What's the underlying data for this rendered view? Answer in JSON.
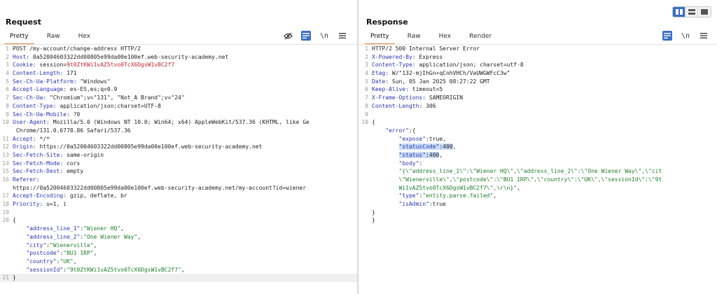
{
  "request": {
    "title": "Request",
    "tabs": [
      {
        "label": "Pretty",
        "active": true
      },
      {
        "label": "Raw",
        "active": false
      },
      {
        "label": "Hex",
        "active": false
      }
    ],
    "newline_toggle": "\\n",
    "lines": [
      {
        "n": "1",
        "text": "POST /my-account/change-address HTTP/2"
      },
      {
        "n": "2",
        "key": "Host:",
        "val": " 0a52004603322dd00805e99da00e100ef.web-security-academy.net"
      },
      {
        "n": "3",
        "key": "Cookie:",
        "val": " session=",
        "red": "9t0ZtKWi1vAZ5tvo0TcX6DgsW1vBC2f7"
      },
      {
        "n": "4",
        "key": "Content-Length:",
        "val": " 171"
      },
      {
        "n": "5",
        "key": "Sec-Ch-Ua-Platform:",
        "val": " \"Windows\""
      },
      {
        "n": "6",
        "key": "Accept-Language:",
        "val": " es-ES,es;q=0.9"
      },
      {
        "n": "7",
        "key": "Sec-Ch-Ua:",
        "val": " \"Chromium\";v=\"131\", \"Not_A Brand\";v=\"24\""
      },
      {
        "n": "8",
        "key": "Content-Type:",
        "val": " application/json;charset=UTF-8"
      },
      {
        "n": "9",
        "key": "Sec-Ch-Ua-Mobile:",
        "val": " ?0"
      },
      {
        "n": "10",
        "key": "User-Agent:",
        "val": " Mozilla/5.0 (Windows NT 10.0; Win64; x64) AppleWebKit/537.36 (KHTML, like Ge"
      },
      {
        "n": "",
        "val": " Chrome/131.0.6778.86 Safari/537.36"
      },
      {
        "n": "11",
        "key": "Accept:",
        "val": " */*"
      },
      {
        "n": "12",
        "key": "Origin:",
        "val": " https://0a52004603322dd00805e99da00e100ef.web-security-academy.net"
      },
      {
        "n": "13",
        "key": "Sec-Fetch-Site:",
        "val": " same-origin"
      },
      {
        "n": "14",
        "key": "Sec-Fetch-Mode:",
        "val": " cors"
      },
      {
        "n": "15",
        "key": "Sec-Fetch-Dest:",
        "val": " empty"
      },
      {
        "n": "16",
        "key": "Referer:",
        "val": ""
      },
      {
        "n": "",
        "val": "https://0a52004603322dd00805e99da00e100ef.web-security-academy.net/my-account?id=wiener"
      },
      {
        "n": "17",
        "key": "Accept-Encoding:",
        "val": " gzip, deflate, br"
      },
      {
        "n": "18",
        "key": "Priority:",
        "val": " u=1, i"
      },
      {
        "n": "19",
        "val": ""
      },
      {
        "n": "20",
        "val": "{"
      },
      {
        "n": "",
        "indent": "    ",
        "jkey": "\"address_line_1\"",
        "jval": "\"Wiener HQ\"",
        "tail": ","
      },
      {
        "n": "",
        "indent": "    ",
        "jkey": "\"address_line_2\"",
        "jval": "\"One Wiener Way\"",
        "tail": ","
      },
      {
        "n": "",
        "indent": "    ",
        "jkey": "\"city\"",
        "jval": "\"Wienerville\"",
        "tail": ","
      },
      {
        "n": "",
        "indent": "    ",
        "jkey": "\"postcode\"",
        "jval": "\"BU1 1RP\"",
        "tail": ","
      },
      {
        "n": "",
        "indent": "    ",
        "jkey": "\"country\"",
        "jval": "\"UK\"",
        "tail": ","
      },
      {
        "n": "",
        "indent": "    ",
        "jkey": "\"sessionId\"",
        "jval": "\"9t0ZtKWi1vAZ5tvo0TcX6DgsW1vBC2f7\"",
        "tail": ","
      },
      {
        "n": "21",
        "val": "}",
        "cur": true
      }
    ]
  },
  "response": {
    "title": "Response",
    "tabs": [
      {
        "label": "Pretty",
        "active": true
      },
      {
        "label": "Raw",
        "active": false
      },
      {
        "label": "Hex",
        "active": false
      },
      {
        "label": "Render",
        "active": false
      }
    ],
    "newline_toggle": "\\n",
    "lines": [
      {
        "n": "1",
        "text": "HTTP/2 500 Internal Server Error"
      },
      {
        "n": "2",
        "key": "X-Powered-By:",
        "val": " Express"
      },
      {
        "n": "3",
        "key": "Content-Type:",
        "val": " application/json; charset=utf-8"
      },
      {
        "n": "4",
        "key": "Etag:",
        "val": " W/\"132-mjIhGn+qCnhVHCh/VaUWGWFcC3w\""
      },
      {
        "n": "5",
        "key": "Date:",
        "val": " Sun, 05 Jan 2025 08:27:22 GMT"
      },
      {
        "n": "6",
        "key": "Keep-Alive:",
        "val": " timeout=5"
      },
      {
        "n": "7",
        "key": "X-Frame-Options:",
        "val": " SAMEORIGIN"
      },
      {
        "n": "8",
        "key": "Content-Length:",
        "val": " 306"
      },
      {
        "n": "9",
        "val": ""
      },
      {
        "n": "10",
        "val": "{"
      },
      {
        "n": "",
        "indent": "    ",
        "jkey": "\"error\"",
        "jval": "",
        "tail": ":{"
      },
      {
        "n": "",
        "indent": "        ",
        "jkey": "\"expose\"",
        "jval": "true",
        "tail": ","
      },
      {
        "n": "",
        "indent": "        ",
        "jkey": "\"statusCode\"",
        "jval": "400",
        "tail": ",",
        "hl": true
      },
      {
        "n": "",
        "indent": "        ",
        "jkey": "\"status\"",
        "jval": "400",
        "tail": ",",
        "hl": true
      },
      {
        "n": "",
        "indent": "        ",
        "jkey": "\"body\"",
        "jval": "",
        "tail": ":"
      },
      {
        "n": "",
        "indent": "        ",
        "str": "\"{\\\"address_line_1\\\":\\\"Wiener HQ\\\",\\\"address_line_2\\\":\\\"One Wiener Way\\\",\\\"cit"
      },
      {
        "n": "",
        "indent": "        ",
        "str": "\\\"Wienerville\\\",\\\"postcode\\\":\\\"BU1 1RP\\\",\\\"country\\\":\\\"UK\\\",\\\"sessionId\\\":\\\"9t"
      },
      {
        "n": "",
        "indent": "        ",
        "str": "Wi1vAZ5tvo0TcX6DgsW1vBC2f7\\\",\\r\\n}\"",
        "tail": ","
      },
      {
        "n": "",
        "indent": "        ",
        "jkey": "\"type\"",
        "jval": "\"entity.parse.failed\"",
        "tail": ","
      },
      {
        "n": "",
        "indent": "        ",
        "jkey": "\"isAdmin\"",
        "jval": "true",
        "tail": ""
      },
      {
        "n": "",
        "indent": "    ",
        "val": "}"
      },
      {
        "n": "",
        "val": "}"
      }
    ]
  }
}
